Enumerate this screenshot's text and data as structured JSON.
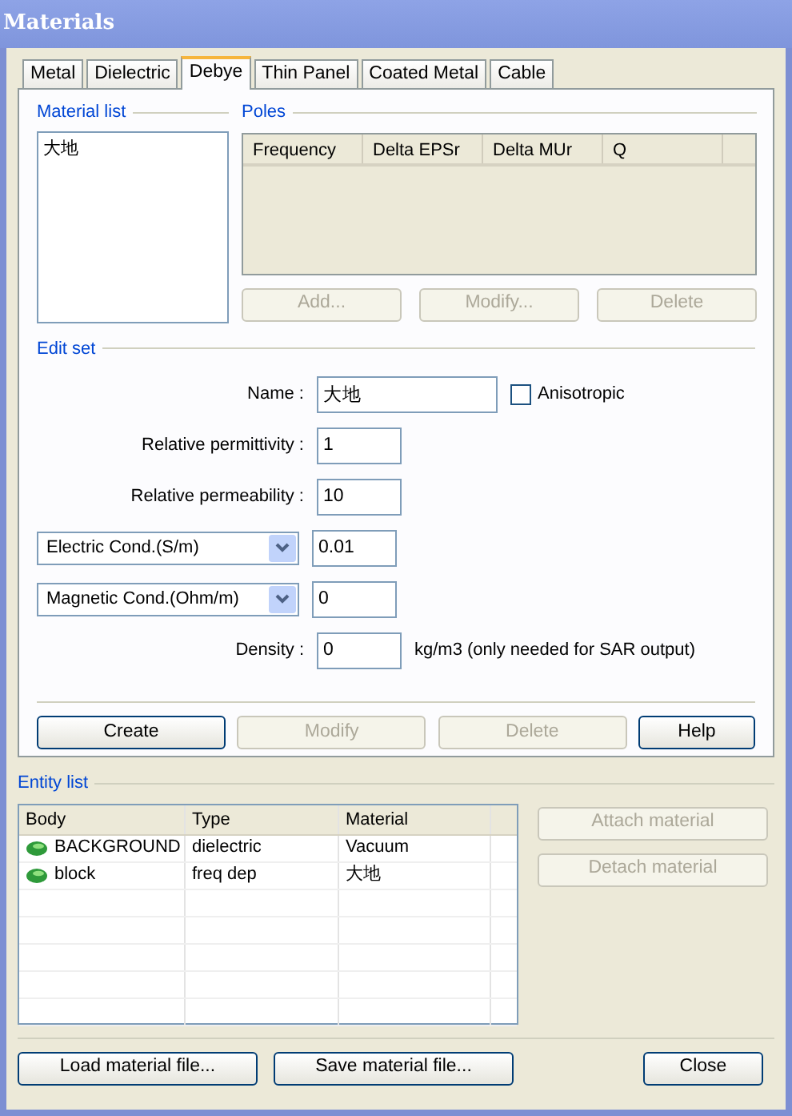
{
  "window": {
    "title": "Materials"
  },
  "tabs": [
    {
      "label": "Metal",
      "selected": false
    },
    {
      "label": "Dielectric",
      "selected": false
    },
    {
      "label": "Debye",
      "selected": true
    },
    {
      "label": "Thin Panel",
      "selected": false
    },
    {
      "label": "Coated Metal",
      "selected": false
    },
    {
      "label": "Cable",
      "selected": false
    }
  ],
  "material_list": {
    "title": "Material list",
    "items": [
      {
        "label": "大地",
        "selected": false
      }
    ]
  },
  "poles": {
    "title": "Poles",
    "columns": [
      "Frequency",
      "Delta EPSr",
      "Delta MUr",
      "Q"
    ],
    "buttons": [
      {
        "label": "Add...",
        "disabled": true
      },
      {
        "label": "Modify...",
        "disabled": true
      },
      {
        "label": "Delete",
        "disabled": true
      }
    ]
  },
  "edit_set": {
    "title": "Edit set",
    "name": {
      "label": "Name :",
      "value": "大地"
    },
    "anisotropic": {
      "label": "Anisotropic",
      "checked": false
    },
    "fields": [
      {
        "kind": "text",
        "label": "Relative permittivity :",
        "value": "1"
      },
      {
        "kind": "text",
        "label": "Relative permeability :",
        "value": "10"
      },
      {
        "kind": "select",
        "label": "Electric Cond.(S/m)",
        "value": "0.01"
      },
      {
        "kind": "select",
        "label": "Magnetic Cond.(Ohm/m)",
        "value": "0"
      },
      {
        "kind": "text",
        "label": "Density :",
        "value": "0",
        "note": "kg/m3  (only needed for SAR output)"
      }
    ],
    "buttons": [
      {
        "label": "Create",
        "disabled": false
      },
      {
        "label": "Modify",
        "disabled": true
      },
      {
        "label": "Delete",
        "disabled": true
      },
      {
        "label": "Help",
        "disabled": false
      }
    ]
  },
  "entity_list": {
    "title": "Entity list",
    "columns": [
      "Body",
      "Type",
      "Material"
    ],
    "rows": [
      {
        "body": "BACKGROUND",
        "type": "dielectric",
        "material": "Vacuum"
      },
      {
        "body": "block",
        "type": "freq dep",
        "material": "大地"
      }
    ],
    "buttons": [
      {
        "label": "Attach material",
        "disabled": true
      },
      {
        "label": "Detach material",
        "disabled": true
      }
    ]
  },
  "footer_buttons": [
    {
      "label": "Load material file...",
      "disabled": false
    },
    {
      "label": "Save material file...",
      "disabled": false
    },
    {
      "label": "Close",
      "disabled": false
    }
  ]
}
